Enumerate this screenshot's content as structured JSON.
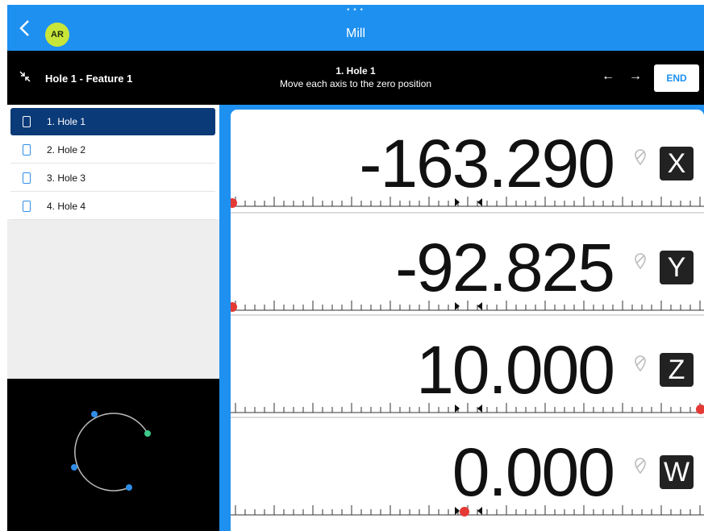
{
  "app": {
    "title": "Mill",
    "user_initials": "AR"
  },
  "header": {
    "feature_name": "Hole 1 - Feature 1",
    "step_title": "1. Hole 1",
    "step_instruction": "Move each axis to the zero position",
    "end_label": "END"
  },
  "steps": [
    {
      "label": "1. Hole 1",
      "selected": true
    },
    {
      "label": "2. Hole 2",
      "selected": false
    },
    {
      "label": "3. Hole 3",
      "selected": false
    },
    {
      "label": "4. Hole 4",
      "selected": false
    }
  ],
  "axes": [
    {
      "name": "X",
      "value": "-163.290"
    },
    {
      "name": "Y",
      "value": "-92.825"
    },
    {
      "name": "Z",
      "value": "10.000"
    },
    {
      "name": "W",
      "value": "0.000"
    }
  ],
  "colors": {
    "accent": "#1e90f0",
    "selected": "#0b3a78",
    "indicator": "#e53935",
    "hole_marker": "#2f8ee8",
    "current_marker": "#3ec98a"
  },
  "icons": [
    "chevron-left-icon",
    "collapse-icon",
    "arrow-left-icon",
    "arrow-right-icon",
    "document-icon",
    "location-pin-icon"
  ]
}
